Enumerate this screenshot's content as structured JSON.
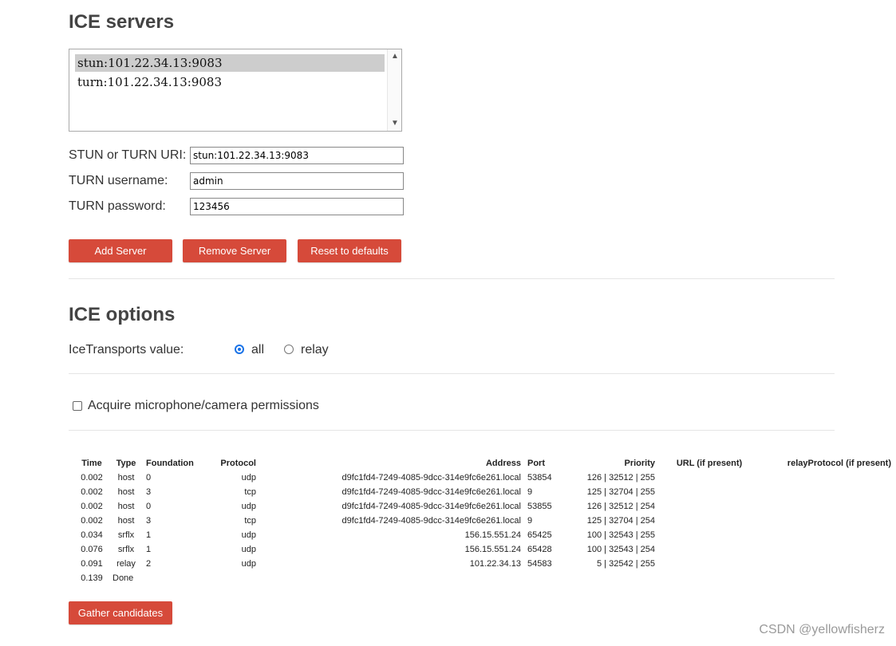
{
  "ice_servers": {
    "heading": "ICE servers",
    "list": [
      {
        "text": "stun:101.22.34.13:9083",
        "selected": true
      },
      {
        "text": "turn:101.22.34.13:9083",
        "selected": false
      }
    ],
    "uri_label": "STUN or TURN URI:",
    "uri_value": "stun:101.22.34.13:9083",
    "username_label": "TURN username:",
    "username_value": "admin",
    "password_label": "TURN password:",
    "password_value": "123456",
    "add_button": "Add Server",
    "remove_button": "Remove Server",
    "reset_button": "Reset to defaults"
  },
  "ice_options": {
    "heading": "ICE options",
    "transports_label": "IceTransports value:",
    "option_all": "all",
    "option_relay": "relay",
    "selected": "all"
  },
  "permissions": {
    "label": "Acquire microphone/camera permissions",
    "checked": false
  },
  "candidates": {
    "headers": {
      "time": "Time",
      "type": "Type",
      "foundation": "Foundation",
      "protocol": "Protocol",
      "address": "Address",
      "port": "Port",
      "priority": "Priority",
      "url": "URL (if present)",
      "relay": "relayProtocol (if present)"
    },
    "rows": [
      {
        "time": "0.002",
        "type": "host",
        "foundation": "0",
        "protocol": "udp",
        "address": "d9fc1fd4-7249-4085-9dcc-314e9fc6e261.local",
        "port": "53854",
        "priority": "126 | 32512 | 255"
      },
      {
        "time": "0.002",
        "type": "host",
        "foundation": "3",
        "protocol": "tcp",
        "address": "d9fc1fd4-7249-4085-9dcc-314e9fc6e261.local",
        "port": "9",
        "priority": "125 | 32704 | 255"
      },
      {
        "time": "0.002",
        "type": "host",
        "foundation": "0",
        "protocol": "udp",
        "address": "d9fc1fd4-7249-4085-9dcc-314e9fc6e261.local",
        "port": "53855",
        "priority": "126 | 32512 | 254"
      },
      {
        "time": "0.002",
        "type": "host",
        "foundation": "3",
        "protocol": "tcp",
        "address": "d9fc1fd4-7249-4085-9dcc-314e9fc6e261.local",
        "port": "9",
        "priority": "125 | 32704 | 254"
      },
      {
        "time": "0.034",
        "type": "srflx",
        "foundation": "1",
        "protocol": "udp",
        "address": "156.15.551.24",
        "port": "65425",
        "priority": "100 | 32543 | 255"
      },
      {
        "time": "0.076",
        "type": "srflx",
        "foundation": "1",
        "protocol": "udp",
        "address": "156.15.551.24",
        "port": "65428",
        "priority": "100 | 32543 | 254"
      },
      {
        "time": "0.091",
        "type": "relay",
        "foundation": "2",
        "protocol": "udp",
        "address": "101.22.34.13",
        "port": "54583",
        "priority": "5 | 32542 | 255"
      }
    ],
    "done_time": "0.139",
    "done_label": "Done"
  },
  "gather_button": "Gather candidates",
  "watermark": "CSDN @yellowfisherz",
  "colors": {
    "button": "#d64a3a",
    "radio_accent": "#1a73e8",
    "selected_item": "#cdcdcd"
  }
}
